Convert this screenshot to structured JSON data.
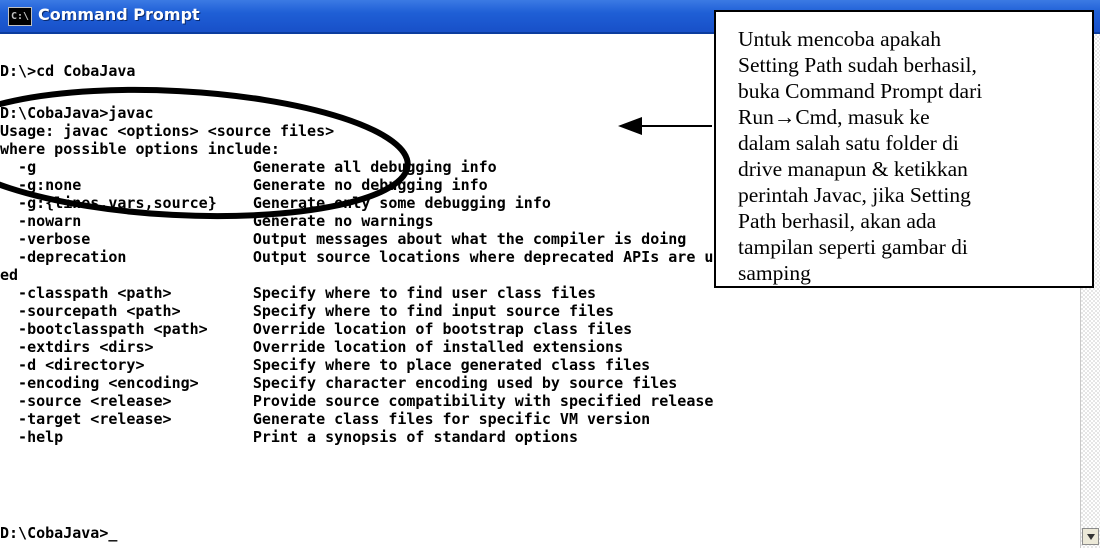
{
  "window": {
    "title": "Command Prompt",
    "icon_label": "C:\\"
  },
  "console": {
    "lines": [
      "",
      "D:\\>cd CobaJava",
      "",
      "D:\\CobaJava>javac",
      "Usage: javac <options> <source files>",
      "where possible options include:",
      "  -g                        Generate all debugging info",
      "  -g:none                   Generate no debugging info",
      "  -g:{lines,vars,source}    Generate only some debugging info",
      "  -nowarn                   Generate no warnings",
      "  -verbose                  Output messages about what the compiler is doing",
      "  -deprecation              Output source locations where deprecated APIs are us",
      "ed",
      "  -classpath <path>         Specify where to find user class files",
      "  -sourcepath <path>        Specify where to find input source files",
      "  -bootclasspath <path>     Override location of bootstrap class files",
      "  -extdirs <dirs>           Override location of installed extensions",
      "  -d <directory>            Specify where to place generated class files",
      "  -encoding <encoding>      Specify character encoding used by source files",
      "  -source <release>         Provide source compatibility with specified release",
      "  -target <release>         Generate class files for specific VM version",
      "  -help                     Print a synopsis of standard options",
      "",
      "",
      "D:\\CobaJava>_"
    ]
  },
  "annotation": {
    "lines": [
      "Untuk mencoba apakah",
      "Setting Path sudah berhasil,",
      "buka Command Prompt dari",
      "Run→Cmd, masuk ke",
      "dalam salah satu folder di",
      "drive manapun & ketikkan",
      "perintah Javac, jika Setting",
      "Path berhasil, akan ada",
      "tampilan seperti gambar di",
      "samping"
    ]
  },
  "colors": {
    "titlebar": "#1f5fd6",
    "console_background": "#ffffff",
    "console_text": "#000000"
  },
  "icons": {
    "window": "cmd-icon",
    "scroll_down": "arrow-down-icon"
  }
}
